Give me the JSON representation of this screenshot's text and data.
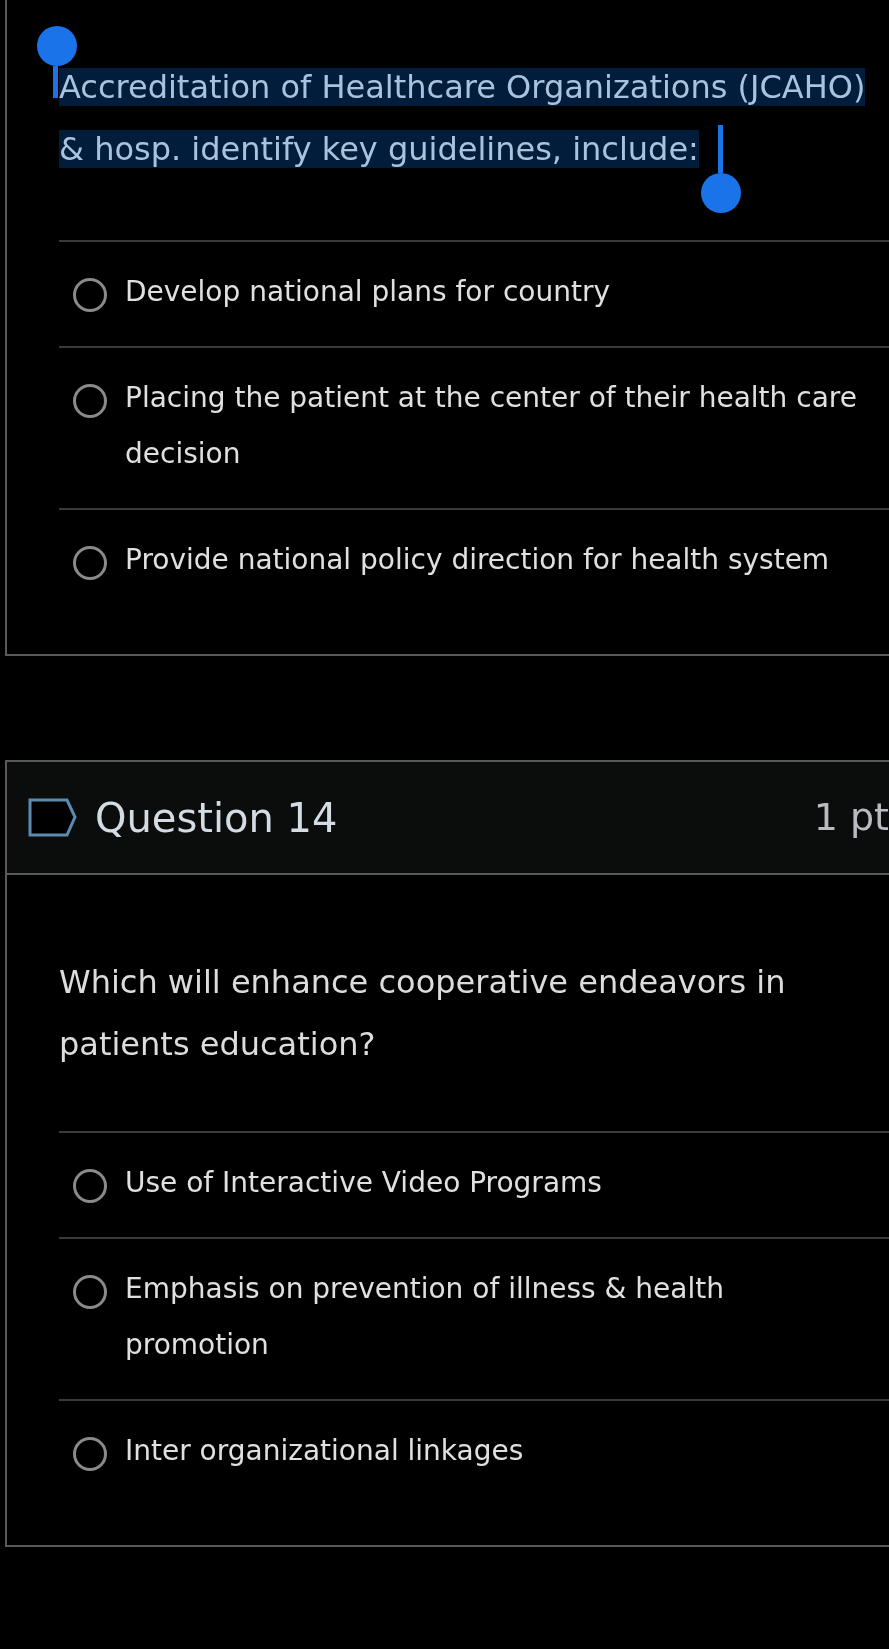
{
  "questions": [
    {
      "text": "Accreditation of Healthcare Organizations (JCAHO) & hosp. identify key guidelines, include:",
      "text_selected": true,
      "answers": [
        {
          "label": "Develop national plans for country",
          "selected": false
        },
        {
          "label": "Placing the patient at the center of their health care decision",
          "selected": false
        },
        {
          "label": "Provide national policy direction for health system",
          "selected": false
        }
      ]
    },
    {
      "header": {
        "title": "Question 14",
        "points": "1 pt",
        "flagged": false
      },
      "text": "Which will enhance cooperative endeavors in patients education?",
      "text_selected": false,
      "answers": [
        {
          "label": "Use of Interactive Video Programs",
          "selected": false
        },
        {
          "label": "Emphasis on prevention of illness & health promotion",
          "selected": false
        },
        {
          "label": "Inter organizational linkages",
          "selected": false
        }
      ]
    }
  ]
}
